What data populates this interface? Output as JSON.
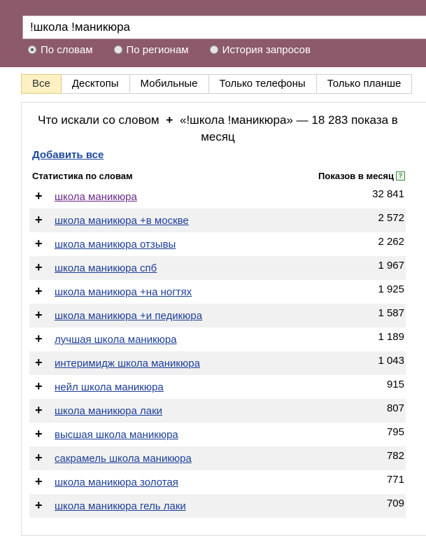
{
  "search": {
    "query": "!школа !маникюра"
  },
  "modes": [
    {
      "label": "По словам",
      "checked": true
    },
    {
      "label": "По регионам",
      "checked": false
    },
    {
      "label": "История запросов",
      "checked": false
    }
  ],
  "tabs": [
    {
      "label": "Все",
      "active": true
    },
    {
      "label": "Десктопы"
    },
    {
      "label": "Мобильные"
    },
    {
      "label": "Только телефоны"
    },
    {
      "label": "Только планше"
    }
  ],
  "results": {
    "heading_prefix": "Что искали со словом",
    "heading_plus": "+",
    "heading_rest": "«!школа !маникюра» — 18 283 показа в месяц",
    "add_all": "Добавить все",
    "col_words": "Статистика по словам",
    "col_count": "Показов в месяц",
    "help": "?",
    "rows": [
      {
        "plus": "+",
        "keyword": "школа маникюра",
        "count": "32 841"
      },
      {
        "plus": "+",
        "keyword": "школа маникюра +в москве",
        "count": "2 572"
      },
      {
        "plus": "+",
        "keyword": "школа маникюра отзывы",
        "count": "2 262"
      },
      {
        "plus": "+",
        "keyword": "школа маникюра спб",
        "count": "1 967"
      },
      {
        "plus": "+",
        "keyword": "школа маникюра +на ногтях",
        "count": "1 925"
      },
      {
        "plus": "+",
        "keyword": "школа маникюра +и педикюра",
        "count": "1 587"
      },
      {
        "plus": "+",
        "keyword": "лучшая школа маникюра",
        "count": "1 189"
      },
      {
        "plus": "+",
        "keyword": "интеримидж школа маникюра",
        "count": "1 043"
      },
      {
        "plus": "+",
        "keyword": "нейл школа маникюра",
        "count": "915"
      },
      {
        "plus": "+",
        "keyword": "школа маникюра лаки",
        "count": "807"
      },
      {
        "plus": "+",
        "keyword": "высшая школа маникюра",
        "count": "795"
      },
      {
        "plus": "+",
        "keyword": "сакрамель школа маникюра",
        "count": "782"
      },
      {
        "plus": "+",
        "keyword": "школа маникюра золотая",
        "count": "771"
      },
      {
        "plus": "+",
        "keyword": "школа маникюра гель лаки",
        "count": "709"
      }
    ]
  }
}
